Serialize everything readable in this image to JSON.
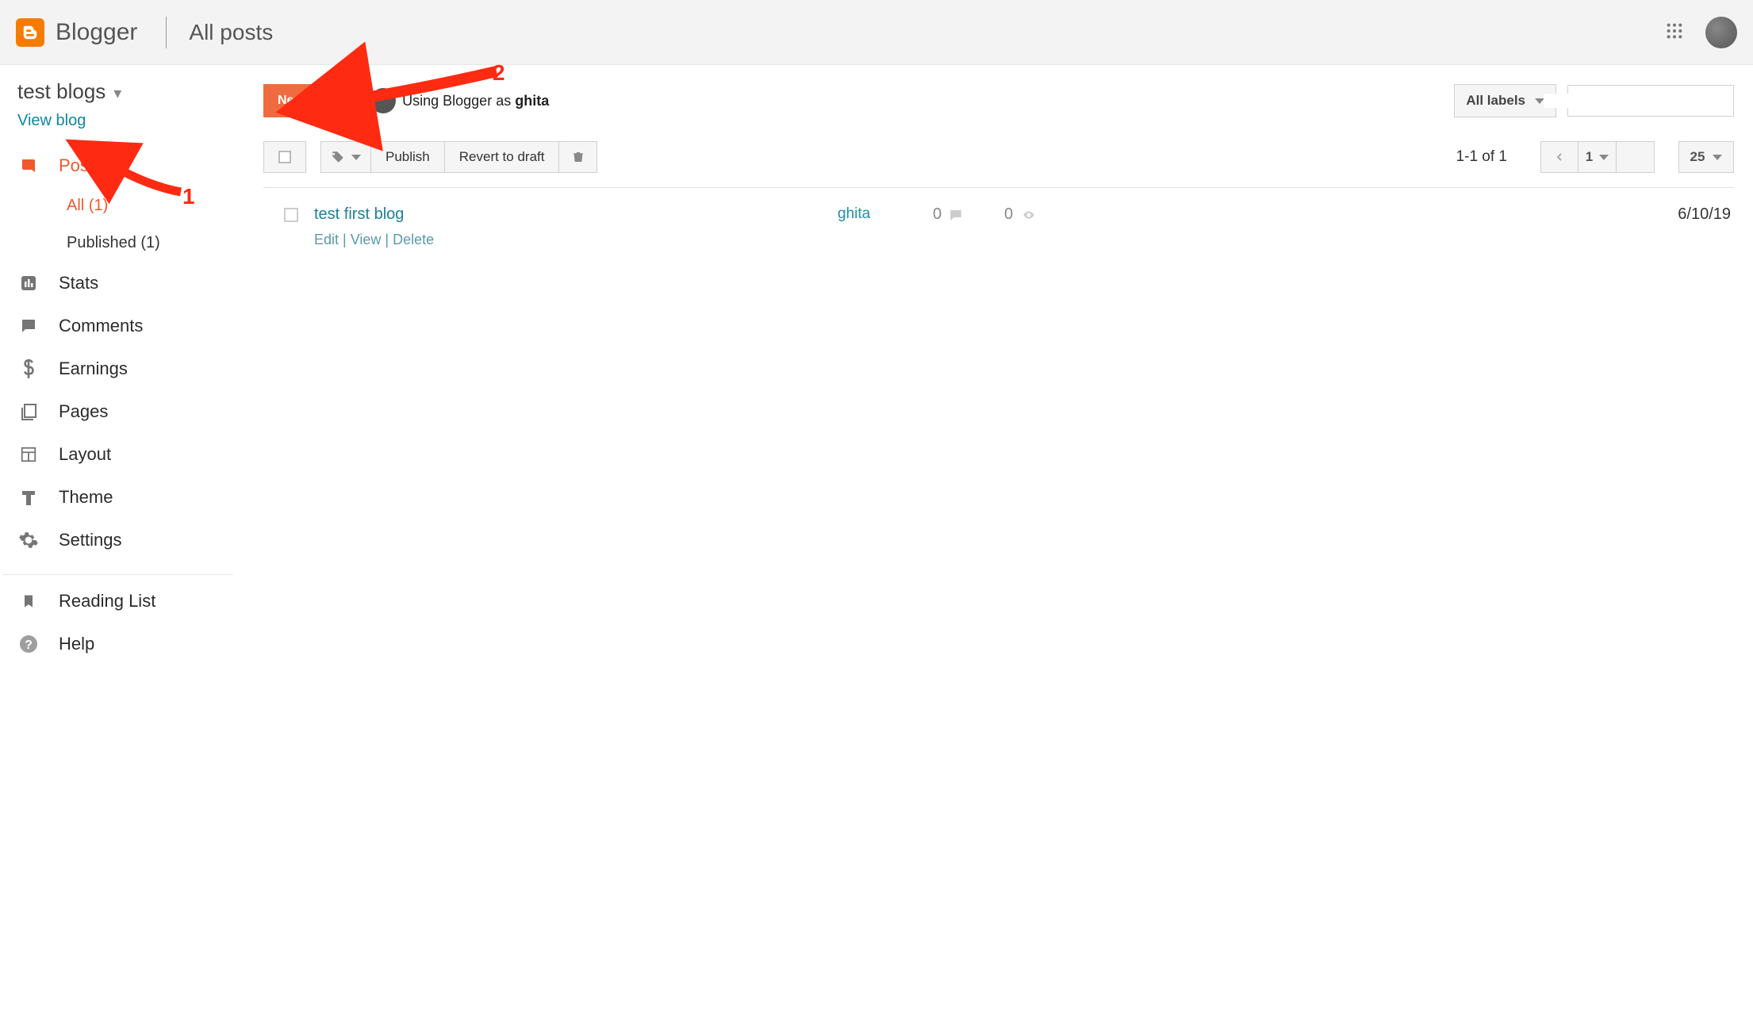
{
  "header": {
    "brand": "Blogger",
    "page_title": "All posts"
  },
  "sidebar": {
    "blog_name": "test blogs",
    "view_blog": "View blog",
    "items": [
      {
        "label": "Posts"
      },
      {
        "label": "Stats"
      },
      {
        "label": "Comments"
      },
      {
        "label": "Earnings"
      },
      {
        "label": "Pages"
      },
      {
        "label": "Layout"
      },
      {
        "label": "Theme"
      },
      {
        "label": "Settings"
      }
    ],
    "posts_sub": [
      {
        "label": "All (1)"
      },
      {
        "label": "Published (1)"
      }
    ],
    "footer_items": [
      {
        "label": "Reading List"
      },
      {
        "label": "Help"
      }
    ]
  },
  "actions": {
    "new_post": "New post",
    "using_prefix": "Using Blogger as ",
    "using_user": "ghita",
    "all_labels": "All labels"
  },
  "toolbar": {
    "publish": "Publish",
    "revert": "Revert to draft",
    "range": "1-1 of 1",
    "page": "1",
    "per_page": "25"
  },
  "posts": [
    {
      "title": "test first blog",
      "edit": "Edit",
      "view": "View",
      "del": "Delete",
      "author": "ghita",
      "comments": "0",
      "views": "0",
      "date": "6/10/19"
    }
  ],
  "annotations": {
    "label1": "1",
    "label2": "2"
  }
}
